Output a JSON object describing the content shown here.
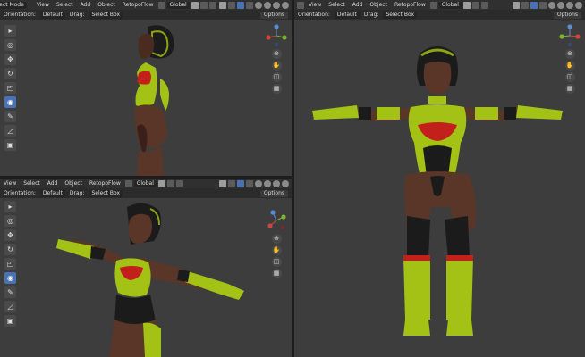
{
  "viewport_top_left": {
    "mode_label": "Object Mode",
    "menu": [
      "View",
      "Select",
      "Add",
      "Object",
      "RetopoFlow"
    ],
    "transform_orientation": "Global",
    "orientation_label": "Orientation:",
    "orientation_value": "Default",
    "drag_label": "Drag:",
    "drag_value": "Select Box",
    "options_label": "Options"
  },
  "viewport_bottom_left": {
    "menu": [
      "View",
      "Select",
      "Add",
      "Object",
      "RetopoFlow"
    ],
    "transform_orientation": "Global",
    "orientation_label": "Orientation:",
    "orientation_value": "Default",
    "drag_label": "Drag:",
    "drag_value": "Select Box",
    "options_label": "Options"
  },
  "viewport_right": {
    "menu": [
      "View",
      "Select",
      "Add",
      "Object",
      "RetopoFlow"
    ],
    "transform_orientation": "Global",
    "orientation_label": "Orientation:",
    "orientation_value": "Default",
    "drag_label": "Drag:",
    "drag_value": "Select Box",
    "options_label": "Options"
  },
  "toolbar_icons": [
    "select-box-icon",
    "cursor-icon",
    "move-icon",
    "rotate-icon",
    "scale-icon",
    "transform-icon",
    "annotate-icon",
    "measure-icon",
    "add-cube-icon"
  ],
  "colors": {
    "viewport_bg": "#3d3d3d",
    "header_bg": "#303030",
    "active_tool": "#4772b3",
    "armor_green": "#a4c216",
    "skin": "#5a3628",
    "red_trim": "#c2201a"
  }
}
